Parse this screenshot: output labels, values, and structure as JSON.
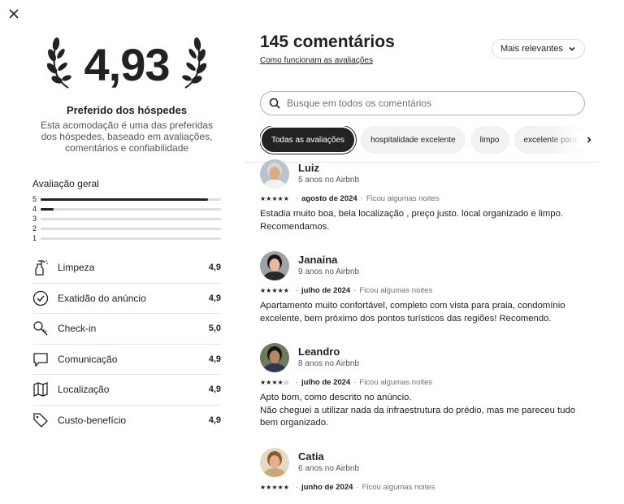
{
  "close_icon": "close-icon",
  "summary": {
    "rating": "4,93",
    "title": "Preferido dos hóspedes",
    "description": "Esta acomodação é uma das preferidas dos hóspedes, baseado em avaliações, comentários e confiabilidade"
  },
  "overall": {
    "title": "Avaliação geral",
    "bars": [
      {
        "star": "5",
        "fraction": 0.93
      },
      {
        "star": "4",
        "fraction": 0.07
      },
      {
        "star": "3",
        "fraction": 0
      },
      {
        "star": "2",
        "fraction": 0
      },
      {
        "star": "1",
        "fraction": 0
      }
    ]
  },
  "categories": [
    {
      "label": "Limpeza",
      "value": "4,9",
      "icon": "spray-bottle-icon"
    },
    {
      "label": "Exatidão do anúncio",
      "value": "4,9",
      "icon": "check-circle-icon"
    },
    {
      "label": "Check-in",
      "value": "5,0",
      "icon": "key-icon"
    },
    {
      "label": "Comunicação",
      "value": "4,9",
      "icon": "chat-bubble-icon"
    },
    {
      "label": "Localização",
      "value": "4,9",
      "icon": "map-icon"
    },
    {
      "label": "Custo-benefício",
      "value": "4,9",
      "icon": "tag-icon"
    }
  ],
  "reviews_header": {
    "count_title": "145 comentários",
    "how_link": "Como funcionam as avaliações",
    "sort_label": "Mais relevantes"
  },
  "search": {
    "placeholder": "Busque em todos os comentários"
  },
  "chips": [
    {
      "label": "Todas as avaliações",
      "active": true
    },
    {
      "label": "hospitalidade excelente",
      "active": false
    },
    {
      "label": "limpo",
      "active": false
    },
    {
      "label": "excelente para",
      "active": false
    }
  ],
  "reviews": [
    {
      "name": "Luiz",
      "tenure": "5 anos no Airbnb",
      "stars": "★★★★★",
      "date": "agosto de 2024",
      "stay": "Ficou algumas noites",
      "text": "Estadia muito boa, bela localização , preço justo. local organizado e limpo. Recomendamos."
    },
    {
      "name": "Janaina",
      "tenure": "9 anos no Airbnb",
      "stars": "★★★★★",
      "date": "julho de 2024",
      "stay": "Ficou algumas noites",
      "text": "Apartamento muito confortável, completo com vista para praia,  condomínio excelente, bem próximo dos pontos turísticos das regiões! Recomendo."
    },
    {
      "name": "Leandro",
      "tenure": "8 anos no Airbnb",
      "stars": "★★★★☆",
      "date": "julho de 2024",
      "stay": "Ficou algumas noites",
      "text": "Apto bom, como descrito no anúncio.\nNão cheguei a utilizar nada da infraestrutura do prédio, mas me pareceu tudo bem organizado."
    },
    {
      "name": "Catia",
      "tenure": "6 anos no Airbnb",
      "stars": "★★★★★",
      "date": "junho de 2024",
      "stay": "Ficou algumas noites",
      "text": ""
    }
  ]
}
